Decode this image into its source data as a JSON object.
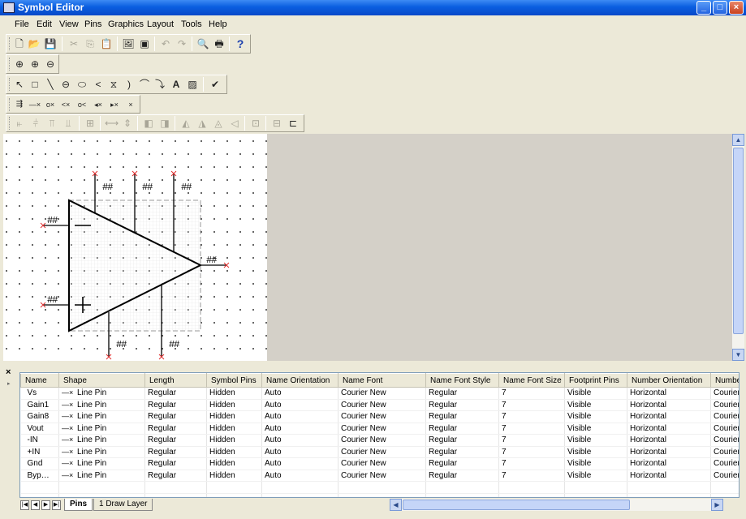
{
  "window": {
    "title": "Symbol Editor"
  },
  "menu": [
    "File",
    "Edit",
    "View",
    "Pins",
    "Graphics",
    "Layout",
    "Tools",
    "Help"
  ],
  "toolbar_file": [
    "new-icon",
    "open-icon",
    "save-icon",
    "cut-icon",
    "copy-icon",
    "paste-icon",
    "image-icon",
    "properties-icon",
    "undo-icon",
    "redo-icon",
    "print-preview-icon",
    "print-icon",
    "help-icon"
  ],
  "toolbar_zoom": [
    "zoom-fit-icon",
    "zoom-in-icon",
    "zoom-out-icon"
  ],
  "toolbar_draw": [
    "select-icon",
    "rectangle-icon",
    "line-icon",
    "polygon-icon",
    "ellipse-icon",
    "polyline-icon",
    "bezier-icon",
    "arc-icon",
    "arc2-icon",
    "curve-icon",
    "text-icon",
    "image-insert-icon",
    "check-icon"
  ],
  "toolbar_pins": [
    "pin-array-icon",
    "line-pin-icon",
    "dot-pin-icon",
    "clock-pin-icon",
    "dot-clock-pin-icon",
    "input-pin-icon",
    "output-pin-icon",
    "no-connect-icon"
  ],
  "symbol": {
    "pin_label": "##",
    "minus_sign": "−",
    "plus_sign": "+"
  },
  "table": {
    "columns": [
      "Name",
      "Shape",
      "Length",
      "Symbol Pins",
      "Name Orientation",
      "Name Font",
      "Name Font Style",
      "Name Font Size",
      "Footprint Pins",
      "Number Orientation",
      "Numbe"
    ],
    "rows": [
      [
        "Vs",
        "Line Pin",
        "Regular",
        "Hidden",
        "Auto",
        "Courier New",
        "Regular",
        "7",
        "Visible",
        "Horizontal",
        "Courier"
      ],
      [
        "Gain1",
        "Line Pin",
        "Regular",
        "Hidden",
        "Auto",
        "Courier New",
        "Regular",
        "7",
        "Visible",
        "Horizontal",
        "Courier"
      ],
      [
        "Gain8",
        "Line Pin",
        "Regular",
        "Hidden",
        "Auto",
        "Courier New",
        "Regular",
        "7",
        "Visible",
        "Horizontal",
        "Courier"
      ],
      [
        "Vout",
        "Line Pin",
        "Regular",
        "Hidden",
        "Auto",
        "Courier New",
        "Regular",
        "7",
        "Visible",
        "Horizontal",
        "Courier"
      ],
      [
        "-IN",
        "Line Pin",
        "Regular",
        "Hidden",
        "Auto",
        "Courier New",
        "Regular",
        "7",
        "Visible",
        "Horizontal",
        "Courier"
      ],
      [
        "+IN",
        "Line Pin",
        "Regular",
        "Hidden",
        "Auto",
        "Courier New",
        "Regular",
        "7",
        "Visible",
        "Horizontal",
        "Courier"
      ],
      [
        "Gnd",
        "Line Pin",
        "Regular",
        "Hidden",
        "Auto",
        "Courier New",
        "Regular",
        "7",
        "Visible",
        "Horizontal",
        "Courier"
      ],
      [
        "Byp…",
        "Line Pin",
        "Regular",
        "Hidden",
        "Auto",
        "Courier New",
        "Regular",
        "7",
        "Visible",
        "Horizontal",
        "Courier"
      ]
    ]
  },
  "tabs": [
    "Pins",
    "1 Draw Layer"
  ],
  "colors": {
    "titlebar": "#0a5ee0",
    "pin_end": "#e03030",
    "outline": "#000000"
  }
}
